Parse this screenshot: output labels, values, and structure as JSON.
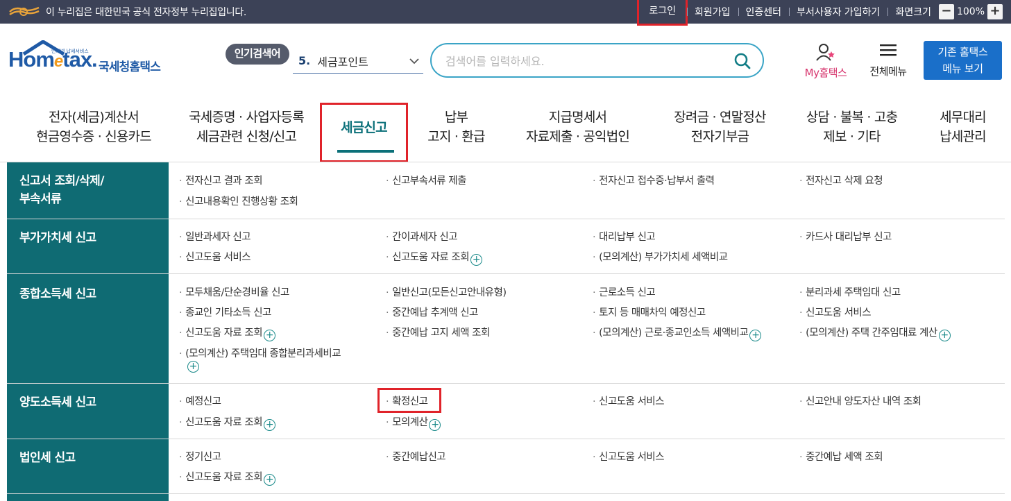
{
  "gov_bar": {
    "notice": "이 누리집은 대한민국 공식 전자정부 누리집입니다.",
    "links": [
      "로그인",
      "회원가입",
      "인증센터",
      "부서사용자 가입하기",
      "화면크기"
    ],
    "zoom": "100%",
    "zoom_minus": "−",
    "zoom_plus": "+"
  },
  "header": {
    "logo_brand_a": "Hom",
    "logo_brand_e": "e",
    "logo_brand_b": "tax.",
    "logo_kr": "국세청홈택스",
    "logo_tag": "인터넷 납세서비스",
    "popular_tag": "인기검색어",
    "popular_num": "5.",
    "popular_keyword": "세금포인트",
    "search_placeholder": "검색어를 입력하세요.",
    "my_home": "My홈택스",
    "all_menu": "전체메뉴",
    "classic_line1": "기존 홈택스",
    "classic_line2": "메뉴 보기"
  },
  "gnb": [
    {
      "l1": "전자(세금)계산서",
      "l2": "현금영수증 · 신용카드"
    },
    {
      "l1": "국세증명 · 사업자등록",
      "l2": "세금관련 신청/신고"
    },
    {
      "l1": "세금신고",
      "l2": ""
    },
    {
      "l1": "납부",
      "l2": "고지 · 환급"
    },
    {
      "l1": "지급명세서",
      "l2": "자료제출 · 공익법인"
    },
    {
      "l1": "장려금 · 연말정산",
      "l2": "전자기부금"
    },
    {
      "l1": "상담 · 불복 · 고충",
      "l2": "제보 · 기타"
    },
    {
      "l1": "세무대리",
      "l2": "납세관리"
    }
  ],
  "sections": [
    {
      "title_l1": "신고서 조회/삭제/",
      "title_l2": "부속서류",
      "links": [
        "전자신고 결과 조회",
        "신고부속서류 제출",
        "전자신고 접수증·납부서 출력",
        "전자신고 삭제 요청",
        "신고내용확인 진행상황 조회"
      ]
    },
    {
      "title_l1": "부가가치세 신고",
      "links": [
        "일반과세자 신고",
        "간이과세자 신고",
        "대리납부 신고",
        "카드사 대리납부 신고",
        "신고도움 서비스",
        "신고도움 자료 조회",
        "(모의계산) 부가가치세 세액비교"
      ]
    },
    {
      "title_l1": "종합소득세 신고",
      "links": [
        "모두채움/단순경비율 신고",
        "일반신고(모든신고안내유형)",
        "근로소득 신고",
        "분리과세 주택임대 신고",
        "종교인 기타소득 신고",
        "중간예납 추계액 신고",
        "토지 등 매매차익 예정신고",
        "신고도움 서비스",
        "신고도움 자료 조회",
        "중간예납 고지 세액 조회",
        "(모의계산) 근로·종교인소득 세액비교",
        "(모의계산) 주택 간주임대료 계산",
        "(모의계산) 주택임대 종합분리과세비교"
      ]
    },
    {
      "title_l1": "양도소득세 신고",
      "links": [
        "예정신고",
        "확정신고",
        "신고도움 서비스",
        "신고안내 양도자산 내역 조회",
        "신고도움 자료 조회",
        "모의계산"
      ]
    },
    {
      "title_l1": "법인세 신고",
      "links": [
        "정기신고",
        "중간예납신고",
        "신고도움 서비스",
        "중간예납 세액 조회",
        "신고도움 자료 조회"
      ]
    }
  ],
  "plus_glyph": "+"
}
